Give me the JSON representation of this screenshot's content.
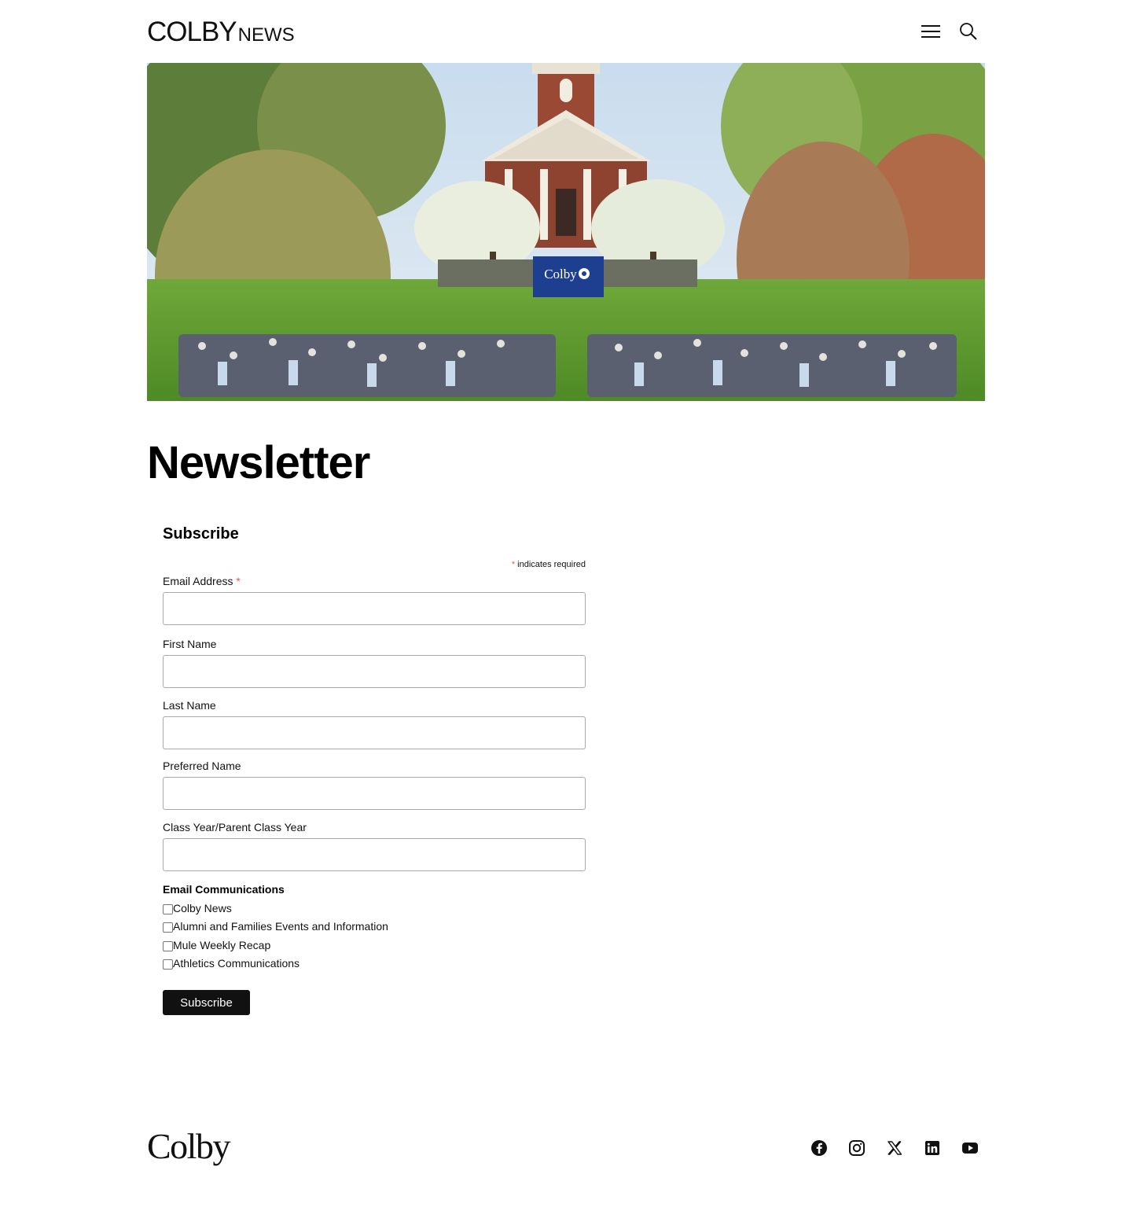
{
  "header": {
    "logo_main": "COLBY",
    "logo_sub": "NEWS",
    "menu_icon": "hamburger-menu-icon",
    "search_icon": "search-icon"
  },
  "hero": {
    "banner_text": "Colby"
  },
  "page": {
    "title": "Newsletter"
  },
  "form": {
    "heading": "Subscribe",
    "required_asterisk": "*",
    "required_note": "indicates required",
    "fields": [
      {
        "label": "Email Address",
        "value": "",
        "required": true
      },
      {
        "label": "First Name",
        "value": ""
      },
      {
        "label": "Last Name",
        "value": ""
      },
      {
        "label": "Preferred Name",
        "value": ""
      },
      {
        "label": "Class Year/Parent Class Year",
        "value": ""
      }
    ],
    "group_label": "Email Communications",
    "options": [
      {
        "label": "Colby News",
        "checked": false
      },
      {
        "label": "Alumni and Families Events and Information",
        "checked": false
      },
      {
        "label": "Mule Weekly Recap",
        "checked": false
      },
      {
        "label": "Athletics Communications",
        "checked": false
      }
    ],
    "submit_label": "Subscribe"
  },
  "footer": {
    "logo": "Colby",
    "social": [
      "facebook-icon",
      "instagram-icon",
      "x-icon",
      "linkedin-icon",
      "youtube-icon"
    ]
  },
  "colors": {
    "accent": "#111111",
    "required": "#e85c41",
    "banner": "#1e3f8f"
  }
}
